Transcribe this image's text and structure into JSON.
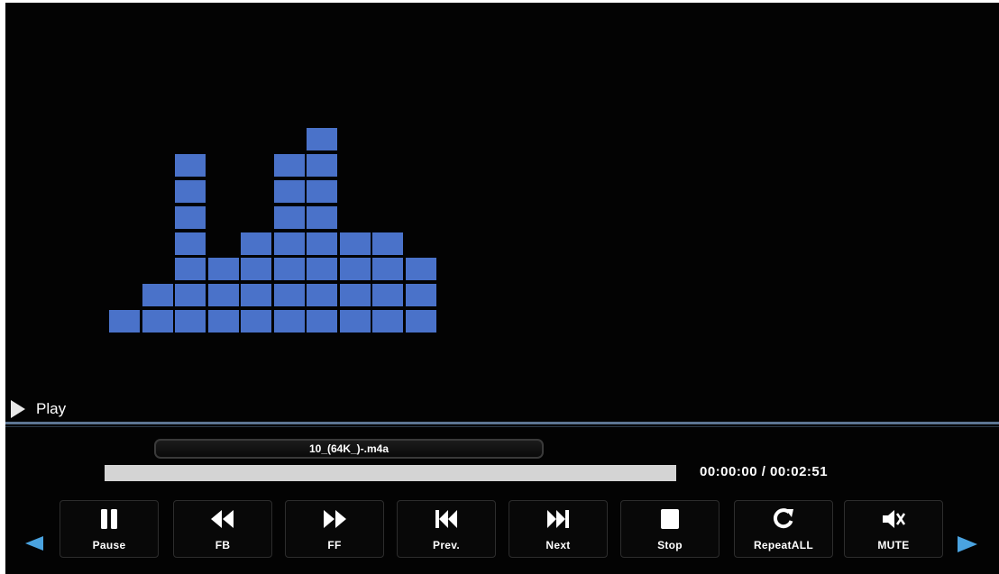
{
  "player": {
    "status_icon": "play-triangle-icon",
    "status_text": "Play",
    "filename": "10_(64K_)-.m4a",
    "time": {
      "current": "00:00:00",
      "separator": " / ",
      "total": "00:02:51",
      "display": "00:00:00 / 00:02:51"
    },
    "progress_fraction": 0.0
  },
  "equalizer": {
    "bar_heights": [
      1,
      2,
      7,
      3,
      4,
      7,
      8,
      4,
      4,
      3
    ],
    "color": "#4a72c9"
  },
  "controls": [
    {
      "id": "pause",
      "label": "Pause",
      "icon": "pause-icon",
      "selected": true
    },
    {
      "id": "fb",
      "label": "FB",
      "icon": "fast-backward-icon",
      "selected": false
    },
    {
      "id": "ff",
      "label": "FF",
      "icon": "fast-forward-icon",
      "selected": false
    },
    {
      "id": "prev",
      "label": "Prev.",
      "icon": "skip-previous-icon",
      "selected": false
    },
    {
      "id": "next",
      "label": "Next",
      "icon": "skip-next-icon",
      "selected": false
    },
    {
      "id": "stop",
      "label": "Stop",
      "icon": "stop-icon",
      "selected": false
    },
    {
      "id": "repeat",
      "label": "RepeatALL",
      "icon": "repeat-icon",
      "selected": false
    },
    {
      "id": "mute",
      "label": "MUTE",
      "icon": "mute-speaker-icon",
      "selected": false
    }
  ],
  "navigation": {
    "left_arrow_icon": "scroll-left-arrow-icon",
    "right_arrow_icon": "scroll-right-arrow-icon",
    "accent_color": "#4aa3e0"
  },
  "colors": {
    "background": "#030303",
    "selection": "#4a8bd6",
    "progress_played": "#d4d4d4"
  }
}
